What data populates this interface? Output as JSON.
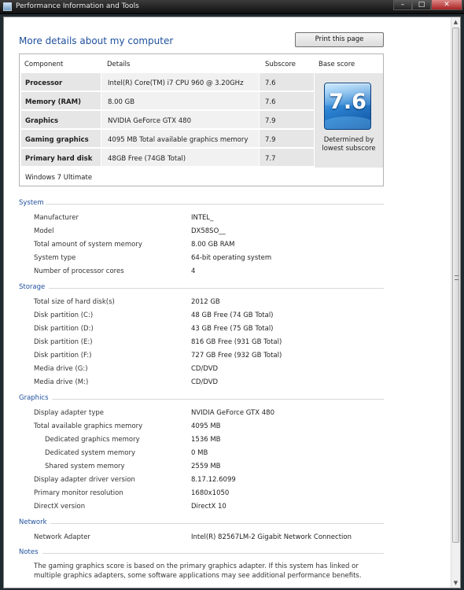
{
  "window": {
    "title": "Performance Information and Tools"
  },
  "page": {
    "title": "More details about my computer",
    "print_label": "Print this page"
  },
  "score_table": {
    "headers": [
      "Component",
      "Details",
      "Subscore",
      "Base score"
    ],
    "rows": [
      {
        "component": "Processor",
        "details": "Intel(R) Core(TM) i7 CPU 960 @ 3.20GHz",
        "subscore": "7.6"
      },
      {
        "component": "Memory (RAM)",
        "details": "8.00 GB",
        "subscore": "7.6"
      },
      {
        "component": "Graphics",
        "details": "NVIDIA GeForce GTX 480",
        "subscore": "7.9"
      },
      {
        "component": "Gaming graphics",
        "details": "4095 MB Total available graphics memory",
        "subscore": "7.9"
      },
      {
        "component": "Primary hard disk",
        "details": "48GB Free (74GB Total)",
        "subscore": "7.7"
      }
    ],
    "base_score": "7.6",
    "base_caption_1": "Determined by",
    "base_caption_2": "lowest subscore",
    "os_edition": "Windows 7 Ultimate"
  },
  "sections": {
    "system": {
      "title": "System",
      "items": [
        {
          "key": "Manufacturer",
          "value": "INTEL_"
        },
        {
          "key": "Model",
          "value": "DX58SO__"
        },
        {
          "key": "Total amount of system memory",
          "value": "8.00 GB RAM"
        },
        {
          "key": "System type",
          "value": "64-bit operating system"
        },
        {
          "key": "Number of processor cores",
          "value": "4"
        }
      ]
    },
    "storage": {
      "title": "Storage",
      "items": [
        {
          "key": "Total size of hard disk(s)",
          "value": "2012 GB"
        },
        {
          "key": "Disk partition (C:)",
          "value": "48 GB Free (74 GB Total)"
        },
        {
          "key": "Disk partition (D:)",
          "value": "43 GB Free (75 GB Total)"
        },
        {
          "key": "Disk partition (E:)",
          "value": "816 GB Free (931 GB Total)"
        },
        {
          "key": "Disk partition (F:)",
          "value": "727 GB Free (932 GB Total)"
        },
        {
          "key": "Media drive (G:)",
          "value": "CD/DVD"
        },
        {
          "key": "Media drive (M:)",
          "value": "CD/DVD"
        }
      ]
    },
    "graphics": {
      "title": "Graphics",
      "items": [
        {
          "key": "Display adapter type",
          "value": "NVIDIA GeForce GTX 480"
        },
        {
          "key": "Total available graphics memory",
          "value": "4095 MB"
        },
        {
          "key": "Dedicated graphics memory",
          "value": "1536 MB"
        },
        {
          "key": "Dedicated system memory",
          "value": "0 MB"
        },
        {
          "key": "Shared system memory",
          "value": "2559 MB"
        },
        {
          "key": "Display adapter driver version",
          "value": "8.17.12.6099"
        },
        {
          "key": "Primary monitor resolution",
          "value": "1680x1050"
        },
        {
          "key": "DirectX version",
          "value": "DirectX 10"
        }
      ]
    },
    "network": {
      "title": "Network",
      "items": [
        {
          "key": "Network Adapter",
          "value": "Intel(R) 82567LM-2 Gigabit Network Connection"
        }
      ]
    },
    "notes": {
      "title": "Notes",
      "text": "The gaming graphics score is based on the primary graphics adapter. If this system has linked or multiple graphics adapters, some software applications may see additional performance benefits."
    }
  },
  "icons": {
    "app": "performance-icon",
    "minimize": "minimize-icon",
    "maximize": "maximize-icon",
    "close": "close-icon",
    "badge": "windows-experience-index-badge"
  },
  "colors": {
    "accent": "#1e4f9c",
    "badge": "#2c84d3",
    "cell_dark": "#e6e6e6",
    "cell_light": "#f1f1f1"
  }
}
